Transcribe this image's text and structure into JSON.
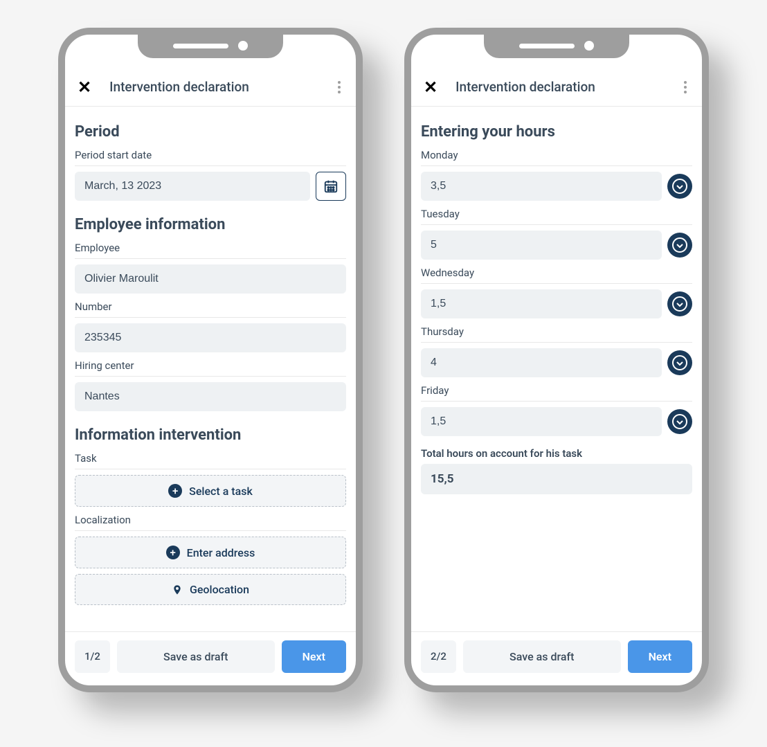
{
  "phone1": {
    "header": {
      "title": "Intervention declaration"
    },
    "sections": {
      "period": {
        "heading": "Period",
        "start_date_label": "Period start date",
        "start_date_value": "March, 13 2023"
      },
      "employee": {
        "heading": "Employee information",
        "employee_label": "Employee",
        "employee_value": "Olivier Maroulit",
        "number_label": "Number",
        "number_value": "235345",
        "center_label": "Hiring center",
        "center_value": "Nantes"
      },
      "intervention": {
        "heading": "Information intervention",
        "task_label": "Task",
        "task_button": "Select a task",
        "localization_label": "Localization",
        "address_button": "Enter address",
        "geo_button": "Geolocation"
      }
    },
    "footer": {
      "pager": "1/2",
      "draft": "Save as draft",
      "next": "Next"
    }
  },
  "phone2": {
    "header": {
      "title": "Intervention declaration"
    },
    "hours": {
      "heading": "Entering your hours",
      "days": [
        {
          "label": "Monday",
          "value": "3,5"
        },
        {
          "label": "Tuesday",
          "value": "5"
        },
        {
          "label": "Wednesday",
          "value": "1,5"
        },
        {
          "label": "Thursday",
          "value": "4"
        },
        {
          "label": "Friday",
          "value": "1,5"
        }
      ],
      "total_label": "Total hours on account for his task",
      "total_value": "15,5"
    },
    "footer": {
      "pager": "2/2",
      "draft": "Save as draft",
      "next": "Next"
    }
  }
}
